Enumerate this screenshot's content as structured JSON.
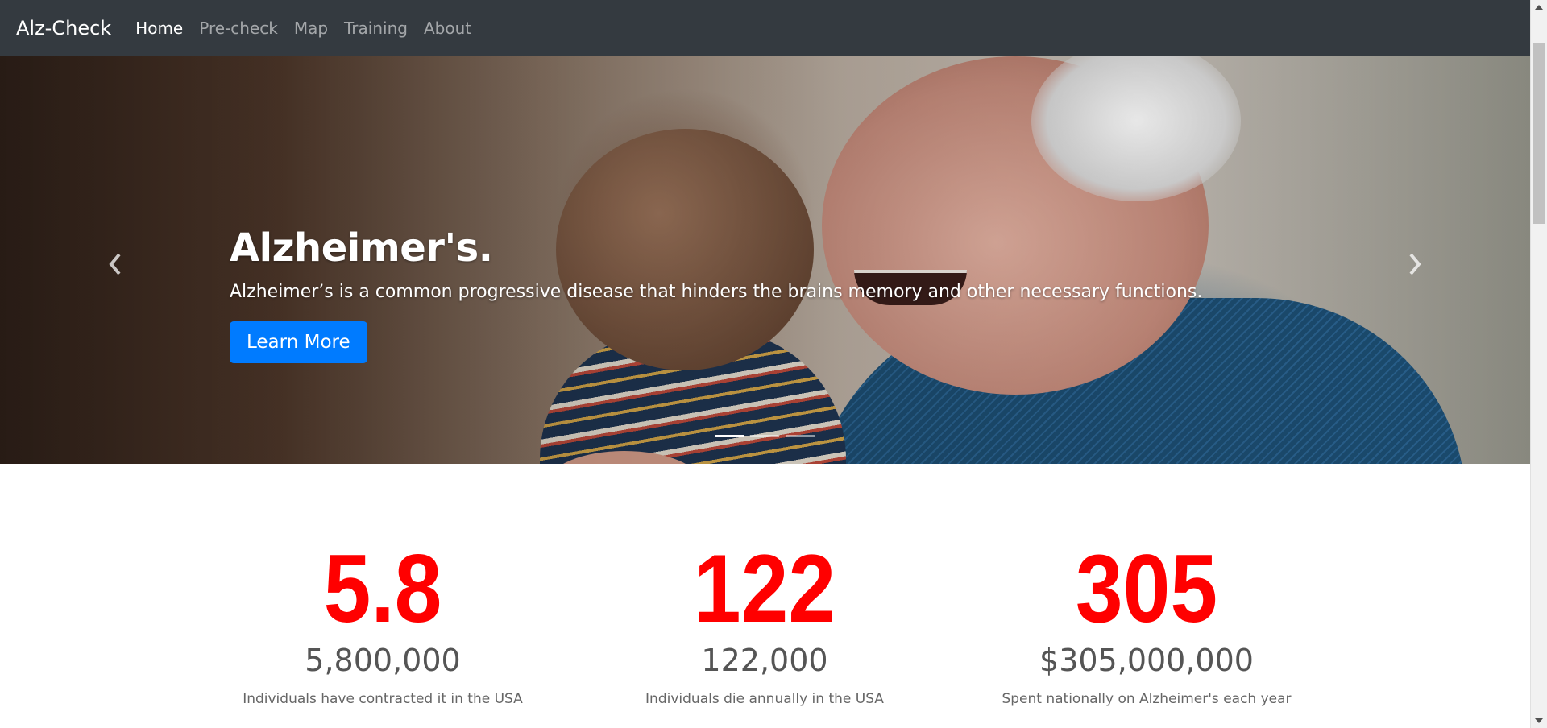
{
  "navbar": {
    "brand": "Alz-Check",
    "items": [
      {
        "label": "Home",
        "active": true
      },
      {
        "label": "Pre-check",
        "active": false
      },
      {
        "label": "Map",
        "active": false
      },
      {
        "label": "Training",
        "active": false
      },
      {
        "label": "About",
        "active": false
      }
    ]
  },
  "hero": {
    "title": "Alzheimer's.",
    "text": "Alzheimer’s is a common progressive disease that hinders the brains memory and other necessary functions.",
    "button_label": "Learn More",
    "prev_icon": "chevron-left-icon",
    "next_icon": "chevron-right-icon",
    "slide_count": 3,
    "active_slide": 1
  },
  "stats": [
    {
      "big": "5.8",
      "number": "5,800,000",
      "desc": "Individuals have contracted it in the USA"
    },
    {
      "big": "122",
      "number": "122,000",
      "desc": "Individuals die annually in the USA"
    },
    {
      "big": "305",
      "number": "$305,000,000",
      "desc": "Spent nationally on Alzheimer's each year"
    }
  ],
  "colors": {
    "navbar_bg": "#343a40",
    "accent_button": "#007bff",
    "stat_red": "#ff0000"
  }
}
